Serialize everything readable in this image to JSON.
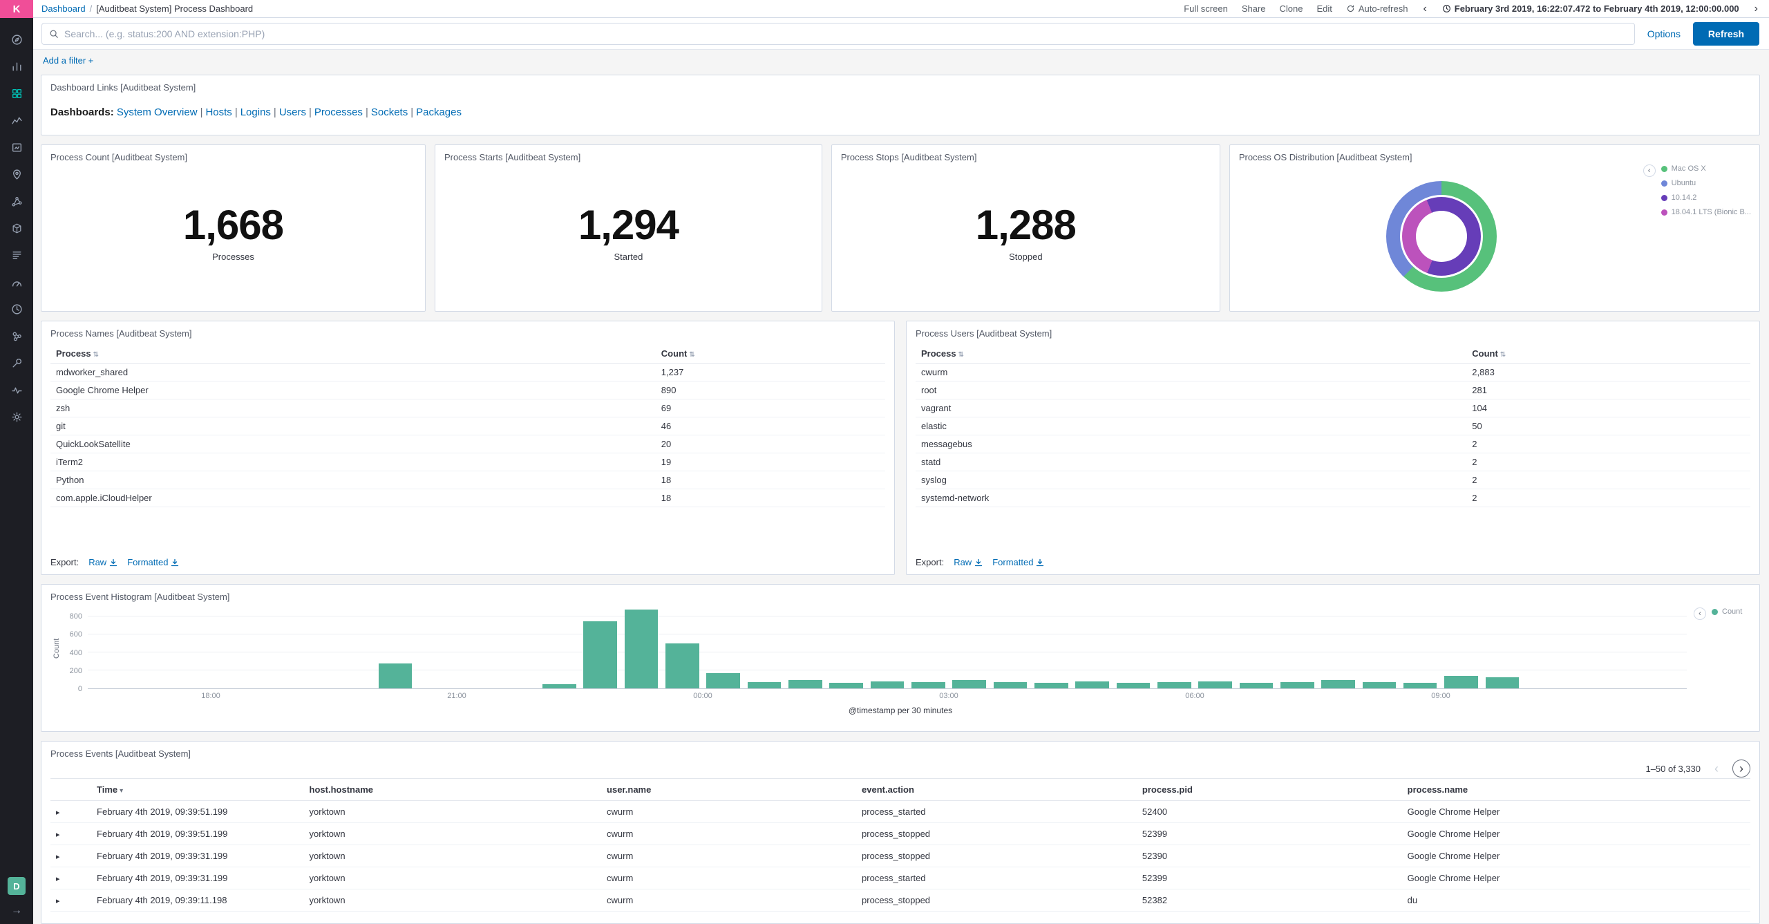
{
  "colors": {
    "accent_blue": "#006BB4",
    "logo_pink": "#F04E98",
    "sidebar_bg": "#1D1E24",
    "histogram_teal": "#54B399",
    "pie_green": "#57C17B",
    "pie_blue": "#6F87D8",
    "pie_purple": "#663DB8",
    "pie_magenta": "#BC52BC"
  },
  "chrome": {
    "logo_letter": "K",
    "space_badge": "D",
    "sidebar_icons": [
      "discover-icon",
      "visualize-icon",
      "dashboard-icon",
      "timelion-icon",
      "canvas-icon",
      "maps-icon",
      "machine-learning-icon",
      "infrastructure-icon",
      "logs-icon",
      "apm-icon",
      "uptime-icon",
      "graph-icon",
      "dev-tools-icon",
      "monitoring-icon",
      "management-icon"
    ]
  },
  "header": {
    "breadcrumb_root": "Dashboard",
    "breadcrumb_separator": "/",
    "breadcrumb_current": "[Auditbeat System] Process Dashboard",
    "menu": {
      "full_screen": "Full screen",
      "share": "Share",
      "clone": "Clone",
      "edit": "Edit",
      "auto_refresh": "Auto-refresh"
    },
    "time_range": "February 3rd 2019, 16:22:07.472 to February 4th 2019, 12:00:00.000"
  },
  "query_bar": {
    "placeholder": "Search... (e.g. status:200 AND extension:PHP)",
    "options_label": "Options",
    "refresh_label": "Refresh"
  },
  "filter_bar": {
    "add_filter": "Add a filter +"
  },
  "panels": {
    "links": {
      "title": "Dashboard Links [Auditbeat System]",
      "prefix": "Dashboards:",
      "separator": "|",
      "items": [
        "System Overview",
        "Hosts",
        "Logins",
        "Users",
        "Processes",
        "Sockets",
        "Packages"
      ]
    },
    "metrics": [
      {
        "title": "Process Count [Auditbeat System]",
        "value": "1,668",
        "label": "Processes"
      },
      {
        "title": "Process Starts [Auditbeat System]",
        "value": "1,294",
        "label": "Started"
      },
      {
        "title": "Process Stops [Auditbeat System]",
        "value": "1,288",
        "label": "Stopped"
      }
    ],
    "os_distribution": {
      "title": "Process OS Distribution [Auditbeat System]"
    },
    "process_names": {
      "title": "Process Names [Auditbeat System]",
      "columns": [
        "Process",
        "Count"
      ],
      "rows": [
        [
          "mdworker_shared",
          "1,237"
        ],
        [
          "Google Chrome Helper",
          "890"
        ],
        [
          "zsh",
          "69"
        ],
        [
          "git",
          "46"
        ],
        [
          "QuickLookSatellite",
          "20"
        ],
        [
          "iTerm2",
          "19"
        ],
        [
          "Python",
          "18"
        ],
        [
          "com.apple.iCloudHelper",
          "18"
        ]
      ],
      "export_label": "Export:",
      "export_raw": "Raw",
      "export_formatted": "Formatted"
    },
    "process_users": {
      "title": "Process Users [Auditbeat System]",
      "columns": [
        "Process",
        "Count"
      ],
      "rows": [
        [
          "cwurm",
          "2,883"
        ],
        [
          "root",
          "281"
        ],
        [
          "vagrant",
          "104"
        ],
        [
          "elastic",
          "50"
        ],
        [
          "messagebus",
          "2"
        ],
        [
          "statd",
          "2"
        ],
        [
          "syslog",
          "2"
        ],
        [
          "systemd-network",
          "2"
        ]
      ],
      "export_label": "Export:",
      "export_raw": "Raw",
      "export_formatted": "Formatted"
    },
    "histogram": {
      "title": "Process Event Histogram [Auditbeat System]",
      "legend_label": "Count"
    },
    "events": {
      "title": "Process Events [Auditbeat System]",
      "pagination": "1–50 of 3,330",
      "columns": [
        "Time",
        "host.hostname",
        "user.name",
        "event.action",
        "process.pid",
        "process.name"
      ],
      "rows": [
        [
          "February 4th 2019, 09:39:51.199",
          "yorktown",
          "cwurm",
          "process_started",
          "52400",
          "Google Chrome Helper"
        ],
        [
          "February 4th 2019, 09:39:51.199",
          "yorktown",
          "cwurm",
          "process_stopped",
          "52399",
          "Google Chrome Helper"
        ],
        [
          "February 4th 2019, 09:39:31.199",
          "yorktown",
          "cwurm",
          "process_stopped",
          "52390",
          "Google Chrome Helper"
        ],
        [
          "February 4th 2019, 09:39:31.199",
          "yorktown",
          "cwurm",
          "process_started",
          "52399",
          "Google Chrome Helper"
        ],
        [
          "February 4th 2019, 09:39:11.198",
          "yorktown",
          "cwurm",
          "process_stopped",
          "52382",
          "du"
        ]
      ]
    }
  },
  "chart_data": [
    {
      "type": "pie",
      "title": "Process OS Distribution [Auditbeat System]",
      "subtype": "two-ring-donut",
      "legend_position": "right",
      "rings": [
        {
          "name": "os",
          "slices": [
            {
              "label": "Mac OS X",
              "value": 62,
              "color": "#57C17B"
            },
            {
              "label": "Ubuntu",
              "value": 38,
              "color": "#6F87D8"
            }
          ]
        },
        {
          "name": "version",
          "slices": [
            {
              "label": "10.14.2",
              "value": 62,
              "color": "#663DB8"
            },
            {
              "label": "18.04.1 LTS (Bionic B...",
              "value": 38,
              "color": "#BC52BC"
            }
          ]
        }
      ]
    },
    {
      "type": "bar",
      "title": "Process Event Histogram [Auditbeat System]",
      "xlabel": "@timestamp per 30 minutes",
      "ylabel": "Count",
      "ylim": [
        0,
        900
      ],
      "yticks": [
        0,
        200,
        400,
        600,
        800
      ],
      "grid": true,
      "legend_position": "right",
      "xticks": [
        {
          "label": "18:00",
          "slot": 3
        },
        {
          "label": "21:00",
          "slot": 9
        },
        {
          "label": "00:00",
          "slot": 15
        },
        {
          "label": "03:00",
          "slot": 21
        },
        {
          "label": "06:00",
          "slot": 27
        },
        {
          "label": "09:00",
          "slot": 33
        }
      ],
      "series": [
        {
          "name": "Count",
          "color": "#54B399",
          "points": [
            [
              "16:30",
              0
            ],
            [
              "17:00",
              0
            ],
            [
              "17:30",
              0
            ],
            [
              "18:00",
              0
            ],
            [
              "18:30",
              0
            ],
            [
              "19:00",
              0
            ],
            [
              "19:30",
              0
            ],
            [
              "20:00",
              280
            ],
            [
              "20:30",
              0
            ],
            [
              "21:00",
              0
            ],
            [
              "21:30",
              0
            ],
            [
              "22:00",
              50
            ],
            [
              "22:30",
              750
            ],
            [
              "23:00",
              880
            ],
            [
              "23:30",
              500
            ],
            [
              "00:00",
              170
            ],
            [
              "00:30",
              70
            ],
            [
              "01:00",
              90
            ],
            [
              "01:30",
              60
            ],
            [
              "02:00",
              80
            ],
            [
              "02:30",
              70
            ],
            [
              "03:00",
              90
            ],
            [
              "03:30",
              70
            ],
            [
              "04:00",
              60
            ],
            [
              "04:30",
              80
            ],
            [
              "05:00",
              60
            ],
            [
              "05:30",
              70
            ],
            [
              "06:00",
              80
            ],
            [
              "06:30",
              60
            ],
            [
              "07:00",
              70
            ],
            [
              "07:30",
              90
            ],
            [
              "08:00",
              70
            ],
            [
              "08:30",
              60
            ],
            [
              "09:00",
              140
            ],
            [
              "09:30",
              120
            ],
            [
              "10:00",
              0
            ],
            [
              "10:30",
              0
            ],
            [
              "11:00",
              0
            ],
            [
              "11:30",
              0
            ]
          ]
        }
      ]
    }
  ]
}
